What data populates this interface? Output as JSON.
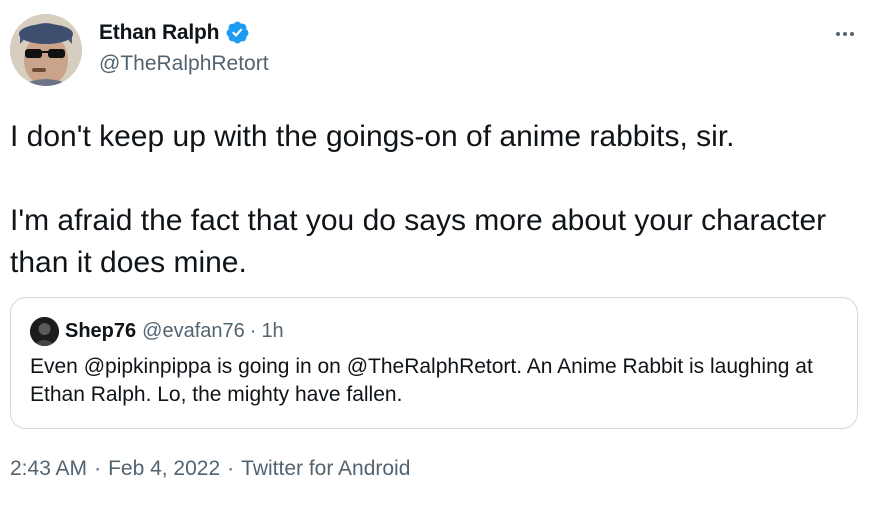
{
  "author": {
    "display_name": "Ethan Ralph",
    "handle": "@TheRalphRetort",
    "verified": true
  },
  "tweet": {
    "paragraphs": [
      "I don't keep up with the goings-on of anime rabbits, sir.",
      "I'm afraid the fact that you do says more about your character than it does mine."
    ]
  },
  "quoted_tweet": {
    "display_name": "Shep76",
    "handle": "@evafan76",
    "separator": "·",
    "time": "1h",
    "text": "Even @pipkinpippa is going in on @TheRalphRetort. An Anime Rabbit is laughing at Ethan Ralph. Lo, the mighty have fallen."
  },
  "meta": {
    "time": "2:43 AM",
    "separator": "·",
    "date": "Feb 4, 2022",
    "source": "Twitter for Android"
  },
  "colors": {
    "verified": "#1d9bf0",
    "secondary_text": "#536471",
    "border": "#cfd9de"
  },
  "icons": {
    "verified": "verified-badge-icon",
    "more": "more-options-icon"
  }
}
